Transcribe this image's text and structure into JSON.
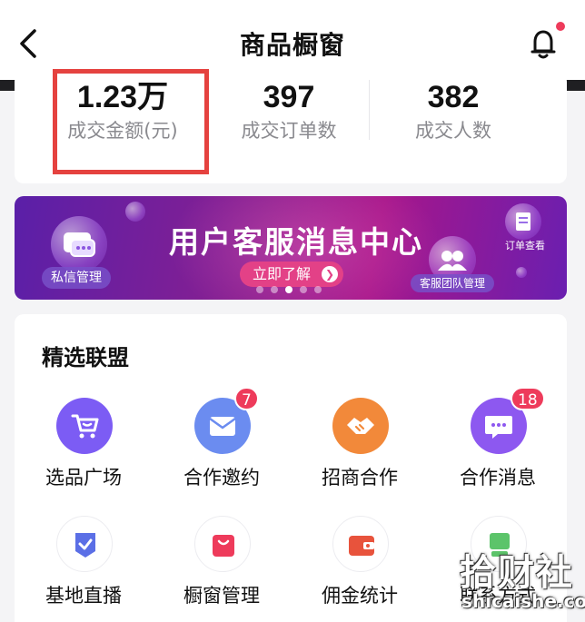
{
  "nav": {
    "title": "商品橱窗",
    "back_icon": "chevron-left-icon",
    "bell_icon": "bell-icon"
  },
  "stats": [
    {
      "value": "1.23万",
      "label": "成交金额(元)"
    },
    {
      "value": "397",
      "label": "成交订单数"
    },
    {
      "value": "382",
      "label": "成交人数"
    }
  ],
  "banner": {
    "title": "用户客服消息中心",
    "button": "立即了解",
    "tags": {
      "left": "私信管理",
      "right": "客服团队管理",
      "top_right": "订单查看"
    }
  },
  "alliance": {
    "title": "精选联盟",
    "items": [
      {
        "label": "选品广场",
        "icon": "cart-icon",
        "color": "#7c5cf4",
        "badge": ""
      },
      {
        "label": "合作邀约",
        "icon": "mail-icon",
        "color": "#6b8cf0",
        "badge": "7"
      },
      {
        "label": "招商合作",
        "icon": "handshake-icon",
        "color": "#f2893a",
        "badge": ""
      },
      {
        "label": "合作消息",
        "icon": "chat-icon",
        "color": "#8d58f0",
        "badge": "18"
      },
      {
        "label": "基地直播",
        "icon": "shield-icon",
        "color": "#5b6fe6",
        "badge": ""
      },
      {
        "label": "橱窗管理",
        "icon": "bag-icon",
        "color": "#ee3b5b",
        "badge": ""
      },
      {
        "label": "佣金统计",
        "icon": "wallet-icon",
        "color": "#e8533c",
        "badge": ""
      },
      {
        "label": "联系方式",
        "icon": "contact-icon",
        "color": "#5cc46a",
        "badge": ""
      }
    ]
  },
  "watermark": {
    "main": "拾财社",
    "sub": "shicaishe.com"
  }
}
